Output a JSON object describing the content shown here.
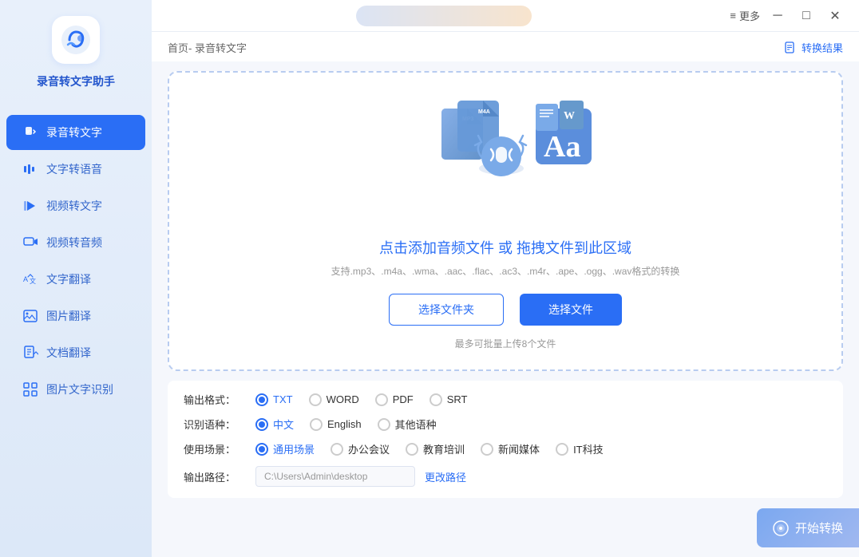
{
  "sidebar": {
    "app_name": "录音转文字助手",
    "items": [
      {
        "id": "audio-to-text",
        "label": "录音转文字",
        "active": true
      },
      {
        "id": "text-to-audio",
        "label": "文字转语音",
        "active": false
      },
      {
        "id": "video-to-text",
        "label": "视频转文字",
        "active": false
      },
      {
        "id": "video-to-audio",
        "label": "视频转音频",
        "active": false
      },
      {
        "id": "text-translate",
        "label": "文字翻译",
        "active": false
      },
      {
        "id": "image-translate",
        "label": "图片翻译",
        "active": false
      },
      {
        "id": "doc-translate",
        "label": "文档翻译",
        "active": false
      },
      {
        "id": "image-ocr",
        "label": "图片文字识别",
        "active": false
      }
    ]
  },
  "titlebar": {
    "more_label": "更多",
    "minimize_label": "─",
    "maximize_label": "□",
    "close_label": "✕"
  },
  "breadcrumb": {
    "text": "首页- 录音转文字"
  },
  "convert_result": {
    "label": "转换结果"
  },
  "dropzone": {
    "title": "点击添加音频文件 或 拖拽文件到此区域",
    "subtitle": "支持.mp3、.m4a、.wma、.aac、.flac、.ac3、.m4r、.ape、.ogg、.wav格式的转换",
    "btn_folder": "选择文件夹",
    "btn_file": "选择文件",
    "hint": "最多可批量上传8个文件"
  },
  "settings": {
    "output_format_label": "输出格式：",
    "output_formats": [
      {
        "id": "txt",
        "label": "TXT",
        "selected": true
      },
      {
        "id": "word",
        "label": "WORD",
        "selected": false
      },
      {
        "id": "pdf",
        "label": "PDF",
        "selected": false
      },
      {
        "id": "srt",
        "label": "SRT",
        "selected": false
      }
    ],
    "language_label": "识别语种：",
    "languages": [
      {
        "id": "zh",
        "label": "中文",
        "selected": true
      },
      {
        "id": "en",
        "label": "English",
        "selected": false
      },
      {
        "id": "other",
        "label": "其他语种",
        "selected": false
      }
    ],
    "scene_label": "使用场景：",
    "scenes": [
      {
        "id": "general",
        "label": "通用场景",
        "selected": true
      },
      {
        "id": "meeting",
        "label": "办公会议",
        "selected": false
      },
      {
        "id": "education",
        "label": "教育培训",
        "selected": false
      },
      {
        "id": "news",
        "label": "新闻媒体",
        "selected": false
      },
      {
        "id": "it",
        "label": "IT科技",
        "selected": false
      }
    ],
    "output_path_label": "输出路径：",
    "output_path_value": "C:\\Users\\Admin\\desktop",
    "change_path_label": "更改路径"
  },
  "start_button": {
    "label": "开始转换"
  },
  "colors": {
    "primary": "#2a6ef5",
    "sidebar_bg": "#e0eaf8",
    "active_item": "#2a6ef5"
  }
}
